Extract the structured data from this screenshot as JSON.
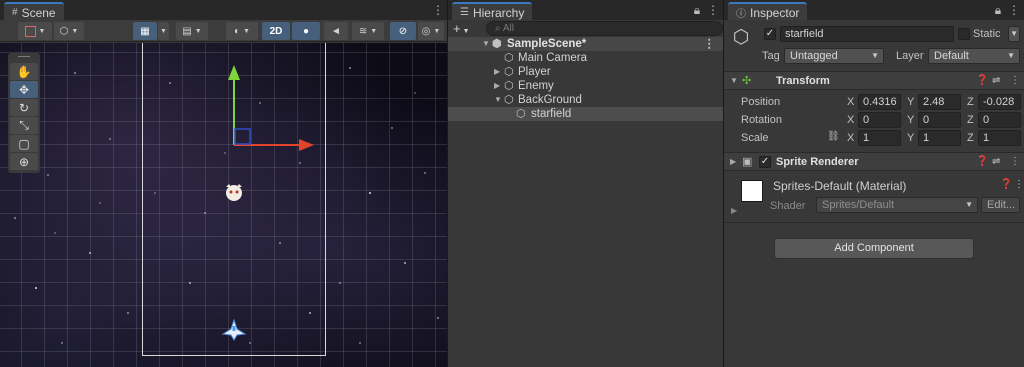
{
  "scene": {
    "tab_label": "Scene",
    "tab_icon": "grid-icon",
    "toolbar": {
      "mode_2d_label": "2D"
    },
    "tools": [
      "hand-tool",
      "move-tool",
      "rotate-tool",
      "scale-tool",
      "rect-tool",
      "transform-tool"
    ]
  },
  "hierarchy": {
    "tab_label": "Hierarchy",
    "add_label": "+",
    "search_placeholder": "All",
    "scene_name": "SampleScene*",
    "items": [
      {
        "label": "Main Camera"
      },
      {
        "label": "Player"
      },
      {
        "label": "Enemy"
      },
      {
        "label": "BackGround"
      },
      {
        "label": "starfield"
      }
    ]
  },
  "inspector": {
    "tab_label": "Inspector",
    "object_name": "starfield",
    "static_label": "Static",
    "tag_label": "Tag",
    "tag_value": "Untagged",
    "layer_label": "Layer",
    "layer_value": "Default",
    "transform": {
      "title": "Transform",
      "position_label": "Position",
      "rotation_label": "Rotation",
      "scale_label": "Scale",
      "axis_x": "X",
      "axis_y": "Y",
      "axis_z": "Z",
      "position": {
        "x": "0.4316",
        "y": "2.48",
        "z": "-0.028"
      },
      "rotation": {
        "x": "0",
        "y": "0",
        "z": "0"
      },
      "scale": {
        "x": "1",
        "y": "1",
        "z": "1"
      }
    },
    "sprite_renderer": {
      "title": "Sprite Renderer"
    },
    "material": {
      "name": "Sprites-Default (Material)",
      "shader_label": "Shader",
      "shader_value": "Sprites/Default",
      "edit_label": "Edit..."
    },
    "add_component_label": "Add Component"
  },
  "colors": {
    "accent": "#3a79bb",
    "y_axis": "#7ed63a",
    "x_axis": "#e0452b",
    "z_handle": "#2f4fc8"
  }
}
